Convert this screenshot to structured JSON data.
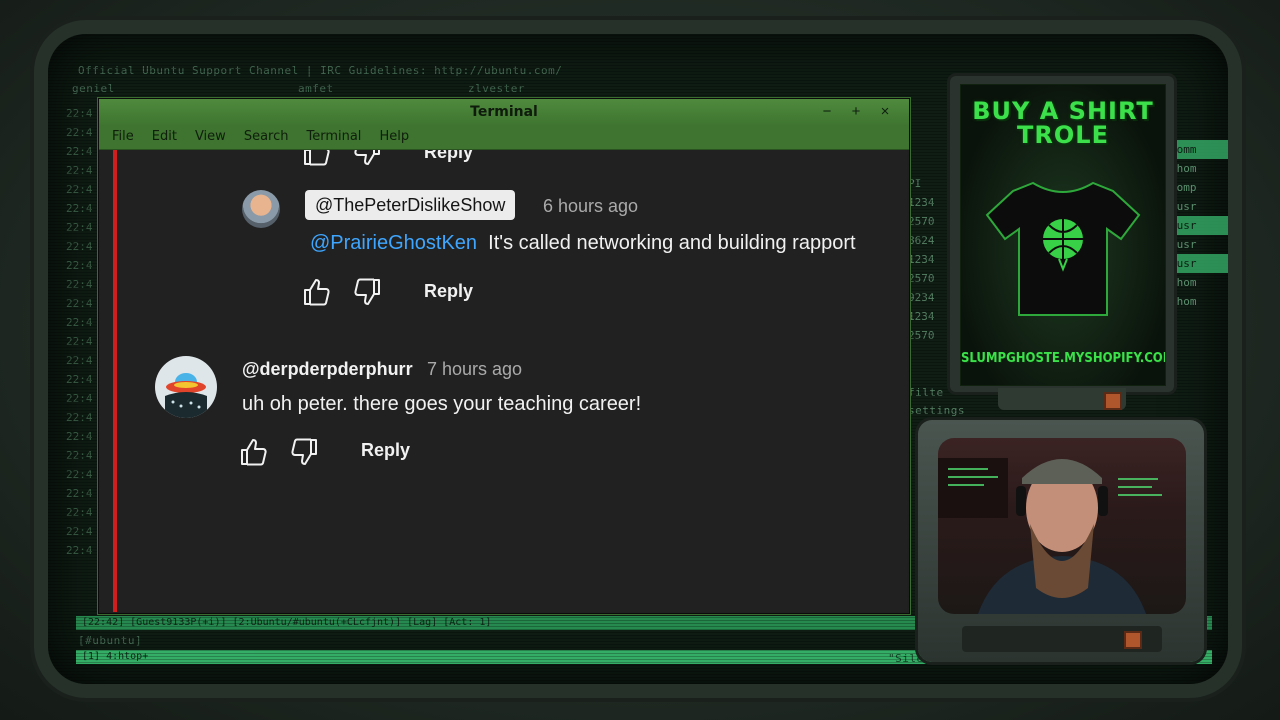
{
  "background": {
    "irc_topic": "Official Ubuntu Support Channel | IRC Guidelines: http://ubuntu.com/",
    "irc_users": [
      "geniel",
      "amfet",
      "zlvester"
    ],
    "irc_times": [
      "22:4",
      "22:4",
      "22:4",
      "22:4",
      "22:4",
      "22:4",
      "22:4",
      "22:4",
      "22:4",
      "22:4",
      "22:4",
      "22:4",
      "22:4",
      "22:4",
      "22:4",
      "22:4",
      "22:4",
      "22:4",
      "22:4",
      "22:4",
      "22:4",
      "22:4",
      "22:4",
      "22:4"
    ],
    "status_bar_1": "[22:42] [Guest9133P(+i)] [2:Ubuntu/#ubuntu(+CLcfjnt)] [Lag] [Act: 1]",
    "status_bar_2": "[#ubuntu]",
    "status_bar_3": "[1] 4:htop+",
    "status_right": "\"Silent Pa",
    "right_items": [
      "Comm",
      "/hom",
      "comp",
      "/usr",
      "/usr",
      "/usr",
      "/usr",
      "/hom",
      "/hom"
    ],
    "mid_items": [
      "PI",
      "1234",
      "2570",
      "8624",
      "1234",
      "2570",
      "9234",
      "1234",
      "2570"
    ],
    "misc_lines": [
      "filte",
      "settings"
    ]
  },
  "terminal": {
    "title": "Terminal",
    "controls": {
      "minimize": "−",
      "maximize": "+",
      "close": "×"
    },
    "menu": [
      "File",
      "Edit",
      "View",
      "Search",
      "Terminal",
      "Help"
    ]
  },
  "comments": {
    "top_partial": {
      "reply": "Reply"
    },
    "reply_1": {
      "handle": "@ThePeterDislikeShow",
      "time": "6 hours ago",
      "mention": "@PrairieGhostKen",
      "text": "It's called networking and building rapport",
      "reply": "Reply"
    },
    "comment_2": {
      "handle": "@derpderpderphurr",
      "time": "7 hours ago",
      "text": "uh oh peter. there goes your teaching career!",
      "reply": "Reply"
    },
    "colors": {
      "mention": "#3ea6ff",
      "accent_rule": "#d01e1e"
    }
  },
  "poster": {
    "title_line_1": "BUY A SHIRT",
    "title_line_2": "TROLE",
    "url": "SLUMPGHOSTE.MYSHOPIFY.COM",
    "accent": "#3be04a"
  },
  "icons": [
    "like-icon",
    "dislike-icon",
    "globe-icon"
  ]
}
